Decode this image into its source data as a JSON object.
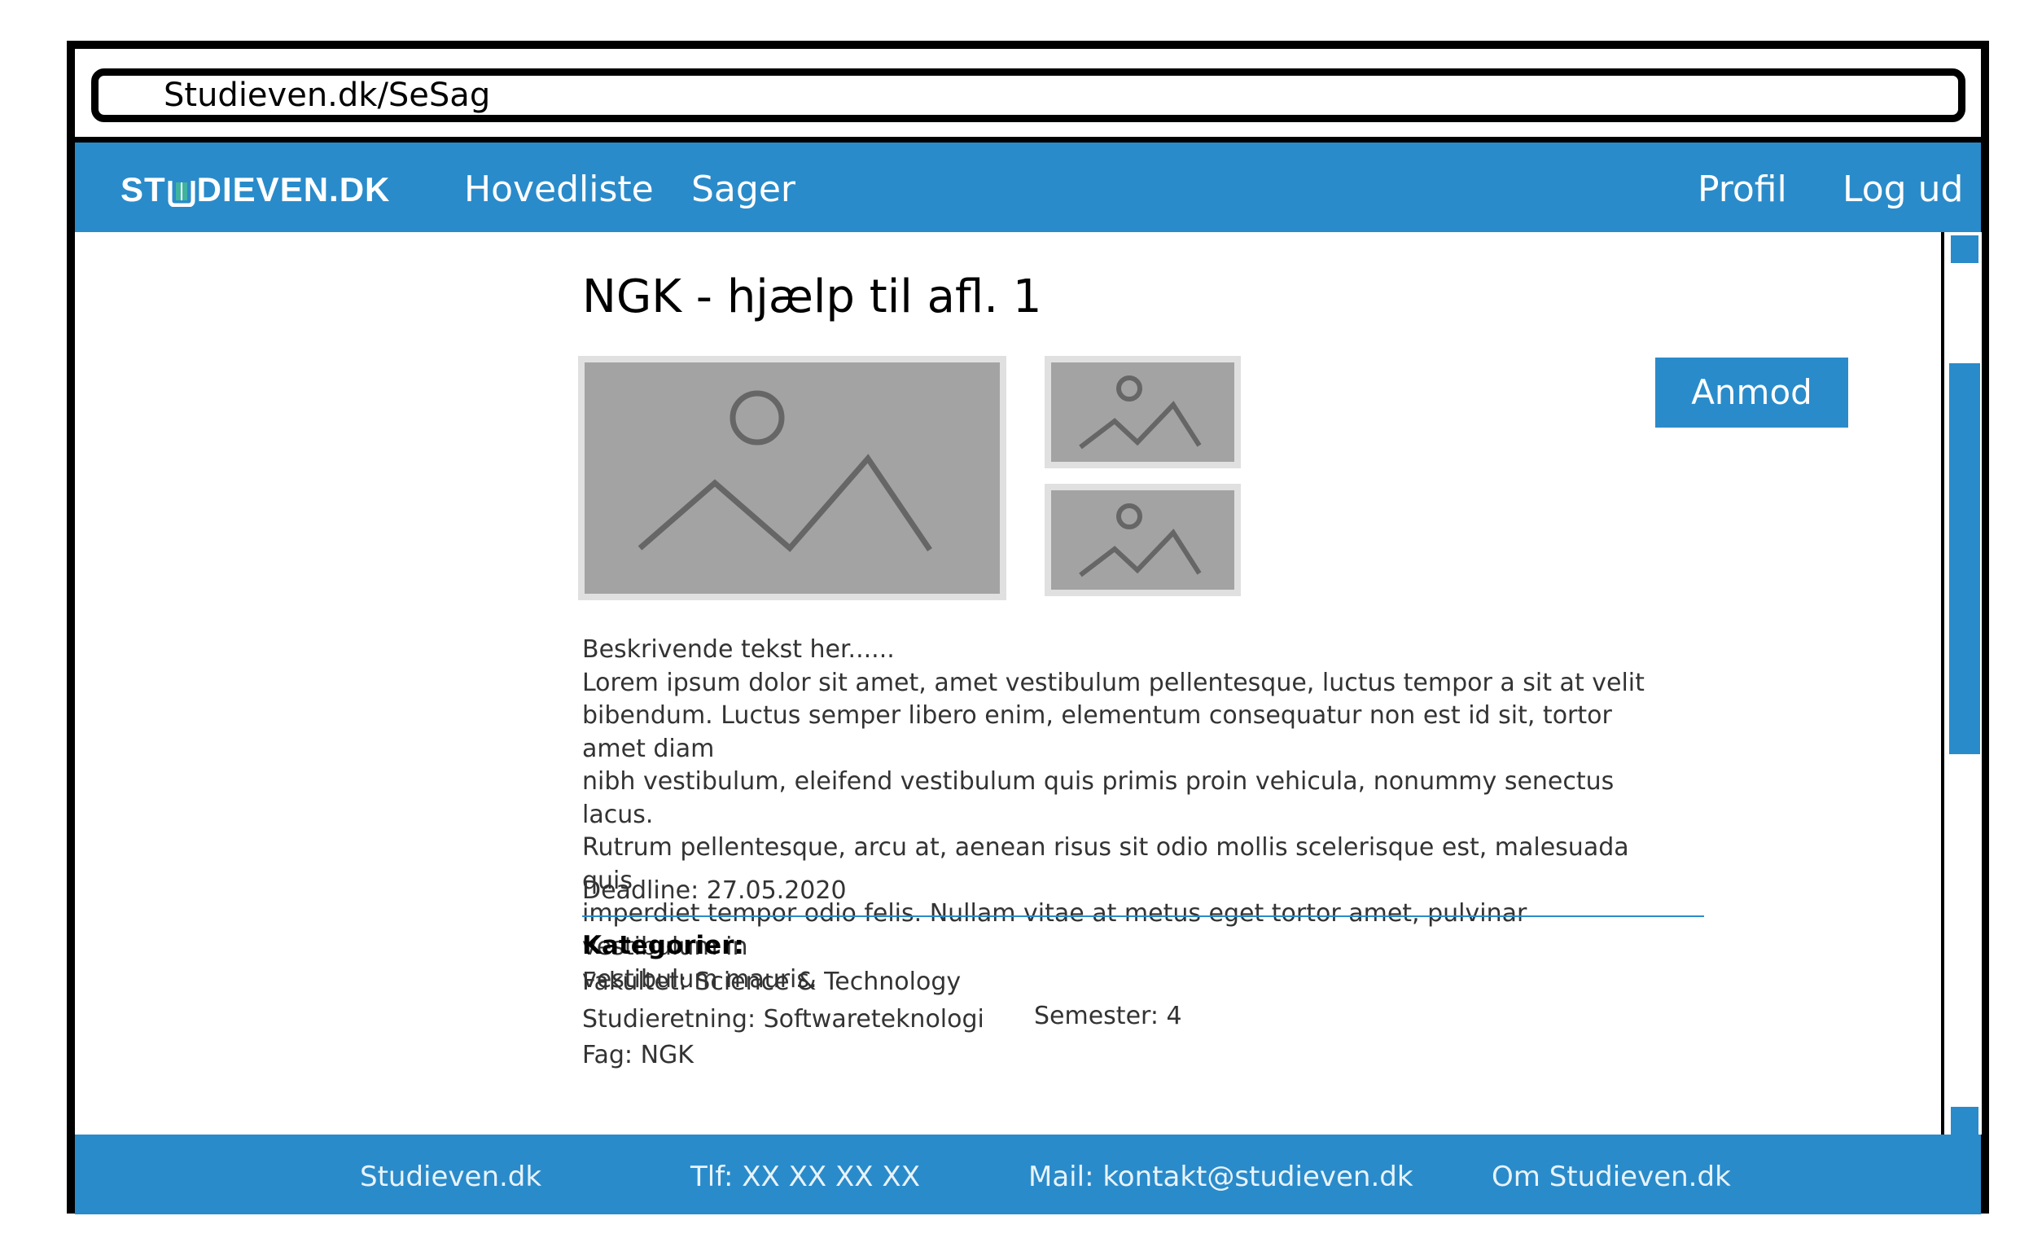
{
  "browser": {
    "url": "Studieven.dk/SeSag"
  },
  "nav": {
    "logo": "STUDIEVEN.DK",
    "logo_left": "ST",
    "logo_right": "DIEVEN.DK",
    "links": [
      "Hovedliste",
      "Sager"
    ],
    "right_links": [
      "Profil",
      "Log ud"
    ]
  },
  "case": {
    "title": "NGK - hjælp til afl. 1",
    "request_label": "Anmod",
    "description_intro": "Beskrivende tekst her......",
    "description_lines": [
      "Lorem ipsum dolor sit amet, amet vestibulum pellentesque, luctus tempor a sit at velit",
      "bibendum. Luctus semper libero enim, elementum consequatur non est id sit, tortor amet diam",
      "nibh vestibulum, eleifend vestibulum quis primis proin vehicula, nonummy senectus lacus.",
      "Rutrum pellentesque, arcu at, aenean risus sit odio mollis scelerisque est, malesuada quis",
      "imperdiet tempor odio felis. Nullam vitae at metus eget tortor amet, pulvinar vestibulum in",
      "vestibulum mauris."
    ],
    "deadline": "Deadline: 27.05.2020",
    "categories": {
      "heading": "Kategorier:",
      "faculty": "Fakultet: Science & Technology",
      "program": "Studieretning: Softwareteknologi",
      "semester": "Semester: 4",
      "subject": "Fag: NGK"
    }
  },
  "footer": {
    "site": "Studieven.dk",
    "phone": "Tlf: XX XX XX XX",
    "mail": "Mail: kontakt@studieven.dk",
    "about": "Om Studieven.dk"
  },
  "colors": {
    "accent": "#2a8bca",
    "placeholder": "#a3a3a3",
    "logo_book": "#3fb3a0"
  }
}
